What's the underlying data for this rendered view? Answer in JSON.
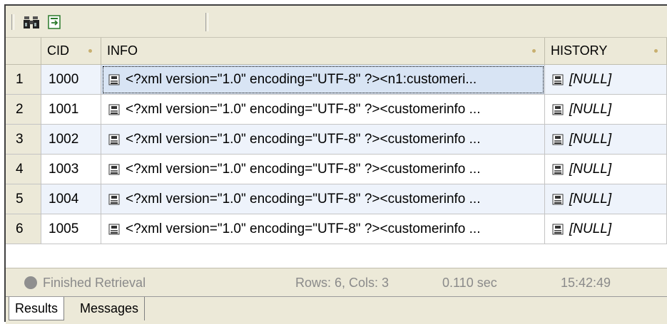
{
  "toolbar": {
    "buttons": [
      {
        "icon": "binoculars-icon"
      },
      {
        "icon": "export-icon"
      }
    ]
  },
  "grid": {
    "columns": [
      "CID",
      "INFO",
      "HISTORY"
    ],
    "rows": [
      {
        "num": "1",
        "cid": "1000",
        "info": "<?xml version=\"1.0\" encoding=\"UTF-8\" ?><n1:customeri...",
        "history": "[NULL]"
      },
      {
        "num": "2",
        "cid": "1001",
        "info": "<?xml version=\"1.0\" encoding=\"UTF-8\" ?><customerinfo ...",
        "history": "[NULL]"
      },
      {
        "num": "3",
        "cid": "1002",
        "info": "<?xml version=\"1.0\" encoding=\"UTF-8\" ?><customerinfo ...",
        "history": "[NULL]"
      },
      {
        "num": "4",
        "cid": "1003",
        "info": "<?xml version=\"1.0\" encoding=\"UTF-8\" ?><customerinfo ...",
        "history": "[NULL]"
      },
      {
        "num": "5",
        "cid": "1004",
        "info": "<?xml version=\"1.0\" encoding=\"UTF-8\" ?><customerinfo ...",
        "history": "[NULL]"
      },
      {
        "num": "6",
        "cid": "1005",
        "info": "<?xml version=\"1.0\" encoding=\"UTF-8\" ?><customerinfo ...",
        "history": "[NULL]"
      }
    ]
  },
  "status": {
    "message": "Finished Retrieval",
    "counts": "Rows: 6, Cols: 3",
    "duration": "0.110 sec",
    "time": "15:42:49"
  },
  "tabs": [
    "Results",
    "Messages"
  ]
}
